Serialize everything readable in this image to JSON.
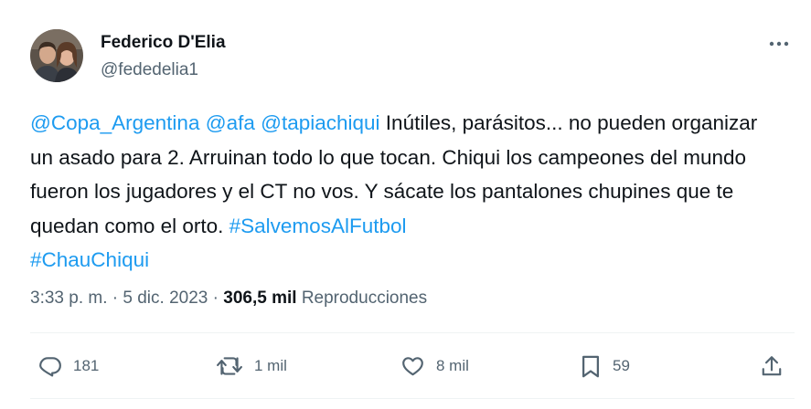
{
  "author": {
    "display_name": "Federico D'Elia",
    "handle": "@fededelia1"
  },
  "tweet": {
    "segments": [
      {
        "type": "mention",
        "text": "@Copa_Argentina"
      },
      {
        "type": "text",
        "text": " "
      },
      {
        "type": "mention",
        "text": "@afa"
      },
      {
        "type": "text",
        "text": " "
      },
      {
        "type": "mention",
        "text": "@tapiachiqui"
      },
      {
        "type": "text",
        "text": " Inútiles, parásitos... no pueden organizar un asado para 2. Arruinan todo lo que tocan. Chiqui los campeones del mundo fueron los jugadores y el CT no vos. Y sácate los pantalones chupines que te quedan como el orto. "
      },
      {
        "type": "hashtag",
        "text": "#SalvemosAlFutbol"
      },
      {
        "type": "text",
        "text": " "
      },
      {
        "type": "hashtag",
        "text": "#ChauChiqui"
      }
    ]
  },
  "meta": {
    "time": "3:33 p. m.",
    "separator": "·",
    "date": "5 dic. 2023",
    "views_count": "306,5 mil",
    "views_label": "Reproducciones"
  },
  "actions": {
    "replies": "181",
    "retweets": "1 mil",
    "likes": "8 mil",
    "bookmarks": "59"
  },
  "colors": {
    "link": "#1d9bf0",
    "secondary": "#536471",
    "primary": "#0f1419"
  },
  "icons": {
    "more": "more-horizontal-icon",
    "reply": "reply-icon",
    "retweet": "retweet-icon",
    "like": "like-heart-icon",
    "bookmark": "bookmark-icon",
    "share": "share-icon"
  }
}
